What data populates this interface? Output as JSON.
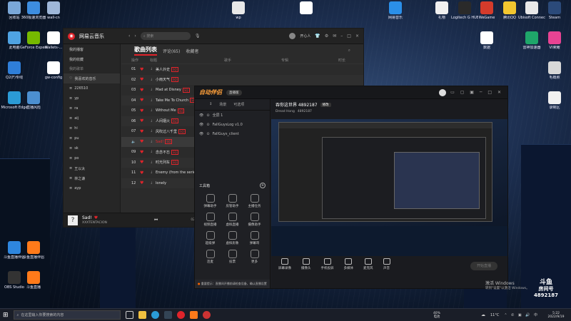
{
  "desktop": {
    "left_icons": [
      {
        "label": "回收站",
        "color": "#7aa7d8"
      },
      {
        "label": "360极速浏览器",
        "color": "#3d8de0"
      },
      {
        "label": "wall-cn",
        "color": "#9fb7d9"
      },
      {
        "label": "此电脑",
        "color": "#4fa3e3"
      },
      {
        "label": "GeForce Experience",
        "color": "#76b900"
      },
      {
        "label": "Wallets-...",
        "color": "#ffffff"
      },
      {
        "label": "Q2(F)专线",
        "color": "#2f7ed8"
      },
      {
        "label": "gw-config",
        "color": "#ffffff"
      },
      {
        "label": "Microsoft Edge",
        "color": "#2b9bd6"
      },
      {
        "label": "直播风险",
        "color": "#4c8fd0"
      }
    ],
    "top_icons": [
      {
        "label": "wp",
        "color": "#e8e8e8"
      },
      {
        "label": "",
        "color": "#ffffff"
      },
      {
        "label": "网易音乐",
        "color": "#2b8fe8"
      },
      {
        "label": "礼物",
        "color": "#f0f0f0"
      }
    ],
    "right_icons": [
      {
        "label": "Logitech G HUB",
        "color": "#2a2a2a"
      },
      {
        "label": "WeGame",
        "color": "#d43b2b"
      },
      {
        "label": "腾讯QQ",
        "color": "#f2c62f"
      },
      {
        "label": "Ubisoft Connect",
        "color": "#e8e8e8"
      },
      {
        "label": "Steam",
        "color": "#2b4a7a"
      },
      {
        "label": "数据",
        "color": "#ffffff"
      },
      {
        "label": "雷神加速器",
        "color": "#1fa66a"
      },
      {
        "label": "VI荣耀",
        "color": "#e84393"
      },
      {
        "label": "毛概照",
        "color": "#d8d8d8"
      },
      {
        "label": "录制区",
        "color": "#f0f0f0"
      }
    ],
    "bottom_icons": [
      {
        "label": "斗鱼直播伴侣",
        "color": "#2e86de"
      },
      {
        "label": "斗鱼直播伴侣",
        "color": "#ff7a1a"
      },
      {
        "label": "OBS Studio",
        "color": "#333333"
      },
      {
        "label": "斗鱼直播",
        "color": "#ff7a1a"
      }
    ]
  },
  "music": {
    "title": "网易云音乐",
    "search_placeholder": "搜索",
    "user": "开心人",
    "sidebar_top": [
      "我的播客",
      "我的收藏"
    ],
    "sidebar_section": "我的歌单",
    "sidebar_items": [
      {
        "icon": "♡",
        "label": "我喜欢的音乐",
        "sel": true
      },
      {
        "label": "226510"
      },
      {
        "label": "yp"
      },
      {
        "label": "ra"
      },
      {
        "label": "aij"
      },
      {
        "label": "hi"
      },
      {
        "label": "pu"
      },
      {
        "label": "sk"
      },
      {
        "label": "po"
      },
      {
        "label": "王以太"
      },
      {
        "label": "林之谦"
      },
      {
        "label": "ayp"
      }
    ],
    "tabs": [
      "歌曲列表",
      "评论(65)",
      "收藏者"
    ],
    "table_headers": [
      "操作",
      "标题",
      "歌手",
      "专辑",
      "时长"
    ],
    "songs": [
      {
        "n": "01",
        "title": "美人外史",
        "tag": "SQ"
      },
      {
        "n": "02",
        "title": "小雨天气",
        "tag": "SQ"
      },
      {
        "n": "03",
        "title": "Mad at Disney",
        "tag": "SQ"
      },
      {
        "n": "04",
        "title": "Take Me To Church",
        "tag": "SQ"
      },
      {
        "n": "05",
        "title": "Without Me",
        "tag": "SQ"
      },
      {
        "n": "06",
        "title": "人间烟火",
        "tag": "SQ"
      },
      {
        "n": "07",
        "title": "风吹过八千里",
        "tag": "SQ"
      },
      {
        "n": "08",
        "title": "Sad!",
        "tag": "SQ",
        "playing": true
      },
      {
        "n": "09",
        "title": "念念不忘",
        "tag": "SQ"
      },
      {
        "n": "10",
        "title": "时光列车",
        "tag": "SQ"
      },
      {
        "n": "11",
        "title": "Enemy (from the series",
        "tag": ""
      },
      {
        "n": "12",
        "title": "lonely",
        "tag": ""
      }
    ],
    "now_playing": {
      "title": "Sad!",
      "artist": "XXXTENTACION",
      "cover": "?",
      "time": "02:40",
      "progress": 0.45
    }
  },
  "live": {
    "title": "自动伴侣",
    "version": "直播版",
    "room_title": "吞你这世界 4892187",
    "room_tag": "修改",
    "streamer": "Dread Hong",
    "room_id": "4892187",
    "left_tabs": [
      "↕",
      "场景",
      "可选项"
    ],
    "sources": [
      "全屏 1",
      "FallGuysLog v1.0",
      "FallGuys_client"
    ],
    "tools_title": "工具箱",
    "tools": [
      "弹幕助手",
      "房管助手",
      "主播任务",
      "视频直播",
      "虚拟直播",
      "摄像助手",
      "超级弹",
      "虚拟形象",
      "弹幕哥",
      "连麦",
      "投票",
      "更多"
    ],
    "notice": "重要提示：直播间开播前请检查设备，确认直播设置",
    "bottom_buttons": [
      "屏幕录像",
      "摄像头",
      "手机投屏",
      "多媒体",
      "麦克风",
      "声音",
      "开始直播"
    ],
    "start_label": "开始直播"
  },
  "taskbar": {
    "search_placeholder": "在这里输入你要搜索的内容",
    "battery": "40%",
    "battery_label": "电池",
    "weather": "11°C",
    "time": "5:22",
    "date": "2022/9/19",
    "watermark_title": "激活 Windows",
    "watermark_sub": "转到\"设置\"以激活 Windows。",
    "douyu": "斗鱼",
    "douyu_sub": "房间号",
    "douyu_room": "4892187"
  }
}
